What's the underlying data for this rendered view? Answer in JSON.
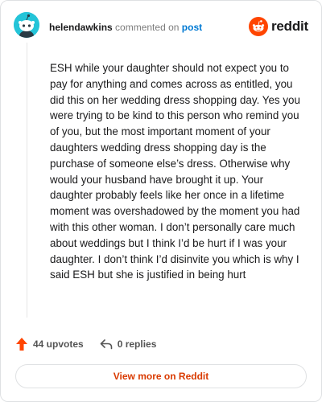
{
  "header": {
    "username": "helendawkins",
    "action_text": "commented on",
    "post_link": "post",
    "brand": "reddit"
  },
  "comment": {
    "text": "ESH while your daughter should not expect you to pay for anything and comes across as entitled, you did this on her wedding dress shopping day. Yes you were trying to be kind to this person who remind you of you, but the most important moment of your daughters wedding dress shopping day is the purchase of someone else’s dress. Otherwise why would your husband have brought it up. Your daughter probably feels like her once in a lifetime moment was overshadowed by the moment you had with this other woman. I don’t personally care much about weddings but I think I’d be hurt if I was your daughter. I don’t think I’d disinvite you which is why I said ESH but she is justified in being hurt"
  },
  "actions": {
    "upvotes": "44 upvotes",
    "replies": "0 replies"
  },
  "footer": {
    "view_more": "View more on Reddit"
  },
  "colors": {
    "brand": "#ff4500",
    "link": "#0079d3",
    "view_more": "#d93a00",
    "avatar_bg": "#24c4d8"
  },
  "icons": {
    "avatar": "snoo-avatar-icon",
    "brand": "reddit-logo-icon",
    "upvote": "upvote-arrow-icon",
    "reply": "reply-icon"
  }
}
